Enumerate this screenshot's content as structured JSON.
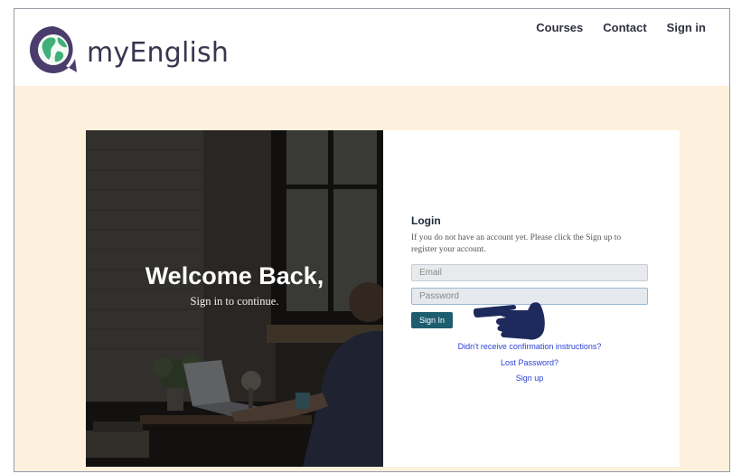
{
  "brand": {
    "name": "myEnglish",
    "icon": "globe-speech-bubble-icon"
  },
  "nav": {
    "items": [
      {
        "label": "Courses"
      },
      {
        "label": "Contact"
      },
      {
        "label": "Sign in"
      }
    ]
  },
  "hero": {
    "title": "Welcome Back,",
    "subtitle": "Sign in to continue."
  },
  "login": {
    "title": "Login",
    "description": "If you do not have an account yet. Please click the Sign up to register your account.",
    "email_placeholder": "Email",
    "password_placeholder": "Password",
    "signin_label": "Sign In",
    "links": [
      {
        "label": "Didn't receive confirmation instructions?"
      },
      {
        "label": "Lost Password?"
      },
      {
        "label": "Sign up"
      }
    ],
    "pointer_icon": "pointing-hand-icon"
  },
  "colors": {
    "page_background": "#fdf0dc",
    "button": "#1d5d6e",
    "link": "#2c3fd6",
    "logo_purple": "#4a3d6b",
    "logo_green": "#3fb07a"
  }
}
